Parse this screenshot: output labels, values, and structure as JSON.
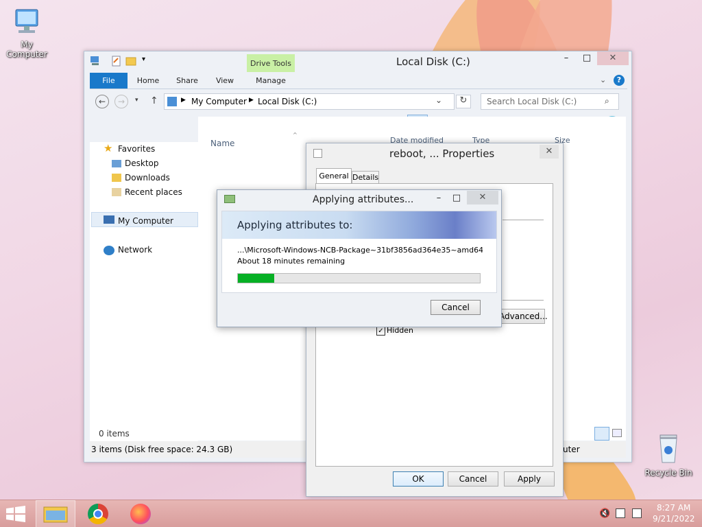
{
  "desktop": {
    "icons": [
      {
        "label": "My Computer",
        "icon": "computer-icon"
      },
      {
        "label": "Recycle Bin",
        "icon": "recycle-bin-icon"
      }
    ]
  },
  "explorer": {
    "title": "Local Disk (C:)",
    "contextual_tab": "Drive Tools",
    "tabs": [
      "File",
      "Home",
      "Share",
      "View",
      "Manage"
    ],
    "path": [
      "My Computer",
      "Local Disk (C:)"
    ],
    "search_placeholder": "Search Local Disk (C:)",
    "nav": {
      "favorites": "Favorites",
      "desktop": "Desktop",
      "downloads": "Downloads",
      "recent": "Recent places",
      "computer": "My Computer",
      "network": "Network"
    },
    "columns": {
      "name": "Name",
      "date": "Date modified",
      "type": "Type",
      "size": "Size"
    },
    "items_count": "0 items",
    "status": "3 items (Disk free space: 24.3 GB)",
    "status_right": "uter"
  },
  "properties": {
    "title": "reboot, ... Properties",
    "tabs": [
      "General",
      "Details"
    ],
    "advanced_label": "Advanced...",
    "hidden_label": "Hidden",
    "ok": "OK",
    "cancel": "Cancel",
    "apply": "Apply"
  },
  "applying": {
    "title": "Applying attributes...",
    "header": "Applying attributes to:",
    "file": "...\\Microsoft-Windows-NCB-Package~31bf3856ad364e35~amd64~",
    "remaining": "About 18 minutes remaining",
    "progress": 0.15,
    "cancel": "Cancel"
  },
  "taskbar": {
    "time": "8:27 AM",
    "date": "9/21/2022"
  },
  "colors": {
    "file_tab": "#1979ca",
    "drive_tools": "#c9f0a5",
    "progress": "#06b025"
  }
}
